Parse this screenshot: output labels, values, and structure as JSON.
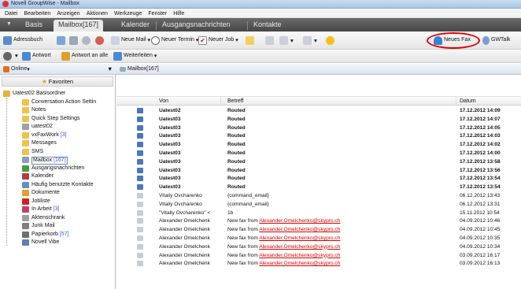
{
  "window": {
    "title": "Novell GroupWise - Mailbox"
  },
  "menu": [
    "Datei",
    "Bearbeiten",
    "Anzeigen",
    "Aktionen",
    "Werkzeuge",
    "Fenster",
    "Hilfe"
  ],
  "tabs": [
    "Basis",
    "Mailbox[167]",
    "Kalender",
    "Ausgangsnachrichten",
    "Kontakte"
  ],
  "toolbar": {
    "adressbuch": "Adressbuch",
    "neue_mail": "Neue Mail",
    "neuer_termin": "Neuer Termin",
    "neuer_job": "Neuer Job",
    "neues_fax": "Neues Fax",
    "gwtalk": "GWTalk",
    "antwort": "Antwort",
    "antwort_alle": "Antwort an alle",
    "weiterleiten": "Weiterleiten"
  },
  "status": {
    "online": "Online"
  },
  "breadcrumb": "Mailbox[167]",
  "sidebar": {
    "favoriten": "Favoriten",
    "items": [
      {
        "label": "Uatest02 Basisordner",
        "count": ""
      },
      {
        "label": "Conversation Action Settin",
        "count": ""
      },
      {
        "label": "Notes",
        "count": ""
      },
      {
        "label": "Quick Step Settings",
        "count": ""
      },
      {
        "label": "uatest02",
        "count": ""
      },
      {
        "label": "vxFaxWork",
        "count": "[3]"
      },
      {
        "label": "Messages",
        "count": ""
      },
      {
        "label": "SMS",
        "count": ""
      },
      {
        "label": "Mailbox",
        "count": "[167]"
      },
      {
        "label": "Ausgangsnachrichten",
        "count": ""
      },
      {
        "label": "Kalender",
        "count": ""
      },
      {
        "label": "Häufig benutzte Kontakte",
        "count": ""
      },
      {
        "label": "Dokumente",
        "count": ""
      },
      {
        "label": "Jobliste",
        "count": ""
      },
      {
        "label": "In Arbeit",
        "count": "[3]"
      },
      {
        "label": "Aktenschrank",
        "count": ""
      },
      {
        "label": "Junk Mail",
        "count": ""
      },
      {
        "label": "Papierkorb",
        "count": "[57]"
      },
      {
        "label": "Novell Vibe",
        "count": ""
      }
    ]
  },
  "columns": {
    "von": "Von",
    "betreff": "Betreff",
    "datum": "Datum"
  },
  "messages": [
    {
      "von": "Uatest02",
      "betreff_prefix": "Routed",
      "betreff_link": "",
      "datum": "17.12.2012 14:09",
      "bold": true
    },
    {
      "von": "Uatest03",
      "betreff_prefix": "Routed",
      "betreff_link": "",
      "datum": "17.12.2012 14:07",
      "bold": true
    },
    {
      "von": "Uatest03",
      "betreff_prefix": "Routed",
      "betreff_link": "",
      "datum": "17.12.2012 14:05",
      "bold": true
    },
    {
      "von": "Uatest03",
      "betreff_prefix": "Routed",
      "betreff_link": "",
      "datum": "17.12.2012 14:03",
      "bold": true
    },
    {
      "von": "Uatest03",
      "betreff_prefix": "Routed",
      "betreff_link": "",
      "datum": "17.12.2012 14:02",
      "bold": true
    },
    {
      "von": "Uatest03",
      "betreff_prefix": "Routed",
      "betreff_link": "",
      "datum": "17.12.2012 14:00",
      "bold": true
    },
    {
      "von": "Uatest03",
      "betreff_prefix": "Routed",
      "betreff_link": "",
      "datum": "17.12.2012 13:58",
      "bold": true
    },
    {
      "von": "Uatest03",
      "betreff_prefix": "Routed",
      "betreff_link": "",
      "datum": "17.12.2012 13:56",
      "bold": true
    },
    {
      "von": "Uatest03",
      "betreff_prefix": "Routed",
      "betreff_link": "",
      "datum": "17.12.2012 13:54",
      "bold": true
    },
    {
      "von": "Uatest03",
      "betreff_prefix": "Routed",
      "betreff_link": "",
      "datum": "17.12.2012 13:54",
      "bold": true
    },
    {
      "von": "Vitaliy Ovcharenko",
      "betreff_prefix": "{command_email}",
      "betreff_link": "",
      "datum": "06.12.2012 13:43",
      "bold": false
    },
    {
      "von": "Vitaliy Ovcharenko",
      "betreff_prefix": "{command_email}",
      "betreff_link": "",
      "datum": "06.12.2012 13:31",
      "bold": false
    },
    {
      "von": "\"Vitaliy Ovcharenko\" <",
      "betreff_prefix": "1b",
      "betreff_link": "",
      "datum": "15.11.2012 10:54",
      "bold": false
    },
    {
      "von": "Alexander Omelchenk",
      "betreff_prefix": "New fax from ",
      "betreff_link": "Alexander.Omelchenko@skypro.ch",
      "datum": "04.09.2012 10:46",
      "bold": false
    },
    {
      "von": "Alexander Omelchenk",
      "betreff_prefix": "New fax from ",
      "betreff_link": "Alexander.Omelchenko@skypro.ch",
      "datum": "04.09.2012 10:45",
      "bold": false
    },
    {
      "von": "Alexander Omelchenk",
      "betreff_prefix": "New fax from ",
      "betreff_link": "Alexander.Omelchenko@skypro.ch",
      "datum": "04.09.2012 10:35",
      "bold": false
    },
    {
      "von": "Alexander Omelchenk",
      "betreff_prefix": "New fax from ",
      "betreff_link": "Alexander.Omelchenko@skypro.ch",
      "datum": "04.09.2012 10:34",
      "bold": false
    },
    {
      "von": "Alexander Omelchenk",
      "betreff_prefix": "New fax from ",
      "betreff_link": "Alexander.Omelchenko@skypro.ch",
      "datum": "03.09.2012 16:17",
      "bold": false
    },
    {
      "von": "Alexander Omelchenk",
      "betreff_prefix": "New fax from ",
      "betreff_link": "Alexander.Omelchenko@skypro.ch",
      "datum": "03.09.2012 16:13",
      "bold": false
    }
  ],
  "colors": {
    "accent_red": "#e00000",
    "link_red": "#dd0000",
    "tab_dark": "#4d4d4d",
    "count_blue": "#2a5bd7"
  }
}
